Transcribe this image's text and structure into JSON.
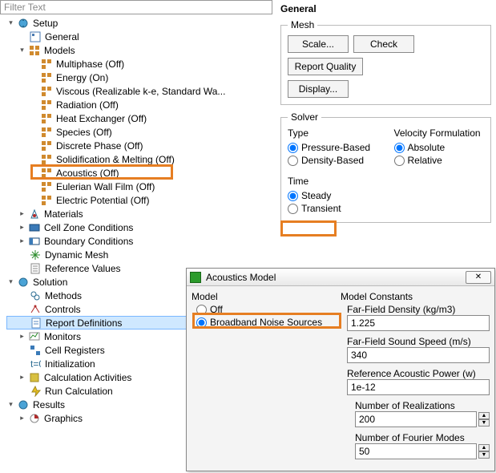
{
  "filter_placeholder": "Filter Text",
  "tree": {
    "setup": "Setup",
    "general": "General",
    "models": "Models",
    "multiphase": "Multiphase (Off)",
    "energy": "Energy (On)",
    "viscous": "Viscous (Realizable k-e, Standard Wa...",
    "radiation": "Radiation (Off)",
    "heatex": "Heat Exchanger (Off)",
    "species": "Species (Off)",
    "disc": "Discrete Phase (Off)",
    "solid": "Solidification & Melting (Off)",
    "acoustics": "Acoustics (Off)",
    "euler": "Eulerian Wall Film (Off)",
    "elec": "Electric Potential (Off)",
    "materials": "Materials",
    "cellzone": "Cell Zone Conditions",
    "bc": "Boundary Conditions",
    "dynmesh": "Dynamic Mesh",
    "refval": "Reference Values",
    "solution": "Solution",
    "methods": "Methods",
    "controls": "Controls",
    "reportdef": "Report Definitions",
    "monitors": "Monitors",
    "cellreg": "Cell Registers",
    "init": "Initialization",
    "calcact": "Calculation Activities",
    "runcalc": "Run Calculation",
    "results": "Results",
    "graphics": "Graphics"
  },
  "panel": {
    "title": "General",
    "mesh": {
      "legend": "Mesh",
      "scale": "Scale...",
      "check": "Check",
      "report": "Report Quality",
      "display": "Display..."
    },
    "solver": {
      "legend": "Solver",
      "type_label": "Type",
      "type_pressure": "Pressure-Based",
      "type_density": "Density-Based",
      "vel_label": "Velocity Formulation",
      "vel_abs": "Absolute",
      "vel_rel": "Relative",
      "time_label": "Time",
      "time_steady": "Steady",
      "time_transient": "Transient"
    }
  },
  "dialog": {
    "title": "Acoustics Model",
    "model_label": "Model",
    "off": "Off",
    "bns": "Broadband Noise Sources",
    "constants_label": "Model Constants",
    "ffd": "Far-Field Density (kg/m3)",
    "ffd_val": "1.225",
    "ffs": "Far-Field Sound Speed (m/s)",
    "ffs_val": "340",
    "rap": "Reference Acoustic Power (w)",
    "rap_val": "1e-12",
    "nr": "Number of Realizations",
    "nr_val": "200",
    "nf": "Number of Fourier Modes",
    "nf_val": "50"
  }
}
